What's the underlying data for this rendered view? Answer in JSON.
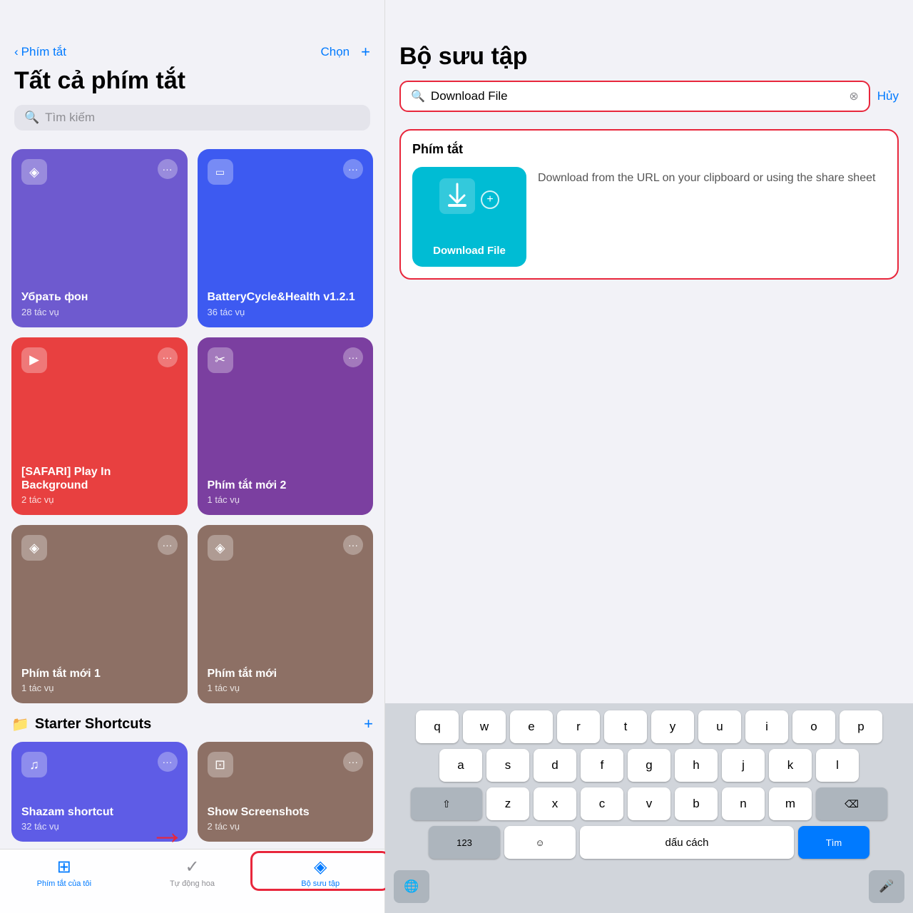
{
  "left": {
    "nav": {
      "back_label": "Phím tắt",
      "action_label": "Chọn",
      "add_label": "+"
    },
    "title": "Tất cả phím tắt",
    "search_placeholder": "Tìm kiếm",
    "shortcuts": [
      {
        "name": "Убрать фон",
        "tasks": "28 tác vụ",
        "color": "card-purple",
        "icon": "◈"
      },
      {
        "name": "BatteryCycle&Health v1.2.1",
        "tasks": "36 tác vụ",
        "color": "card-blue-dark",
        "icon": "▭"
      },
      {
        "name": "[SAFARI] Play In Background",
        "tasks": "2 tác vụ",
        "color": "card-red",
        "icon": "▶"
      },
      {
        "name": "Phím tắt mới 2",
        "tasks": "1 tác vụ",
        "color": "card-violet",
        "icon": "✂"
      },
      {
        "name": "Phím tắt mới 1",
        "tasks": "1 tác vụ",
        "color": "card-brown1",
        "icon": "◈"
      },
      {
        "name": "Phím tắt mới",
        "tasks": "1 tác vụ",
        "color": "card-brown2",
        "icon": "◈"
      }
    ],
    "starter_section": {
      "title": "Starter Shortcuts",
      "add_label": "+"
    },
    "starter_shortcuts": [
      {
        "name": "Shazam shortcut",
        "tasks": "32 tác vụ",
        "color": "#5e5ce6",
        "icon": "♫"
      },
      {
        "name": "Show Screenshots",
        "tasks": "2 tác vụ",
        "color": "#8d7065",
        "icon": "⊡"
      }
    ],
    "tabs": [
      {
        "label": "Phím tắt của tôi",
        "icon": "⊞",
        "active": true
      },
      {
        "label": "Tự động hoa",
        "icon": "✓",
        "active": false
      },
      {
        "label": "Bộ sưu tập",
        "icon": "◈",
        "active": false
      }
    ]
  },
  "right": {
    "title": "Bộ sưu tập",
    "search_value": "Download File",
    "cancel_label": "Hủy",
    "results_section_title": "Phím tắt",
    "result_name": "Download File",
    "result_description": "Download from the URL on your clipboard or using the share sheet",
    "keyboard": {
      "row1": [
        "q",
        "w",
        "e",
        "r",
        "t",
        "y",
        "u",
        "i",
        "o",
        "p"
      ],
      "row2": [
        "a",
        "s",
        "d",
        "f",
        "g",
        "h",
        "j",
        "k",
        "l"
      ],
      "row3": [
        "z",
        "x",
        "c",
        "v",
        "b",
        "n",
        "m"
      ],
      "space_label": "dấu cách",
      "search_label": "Tìm",
      "numbers_label": "123",
      "emoji_label": "☺"
    }
  }
}
